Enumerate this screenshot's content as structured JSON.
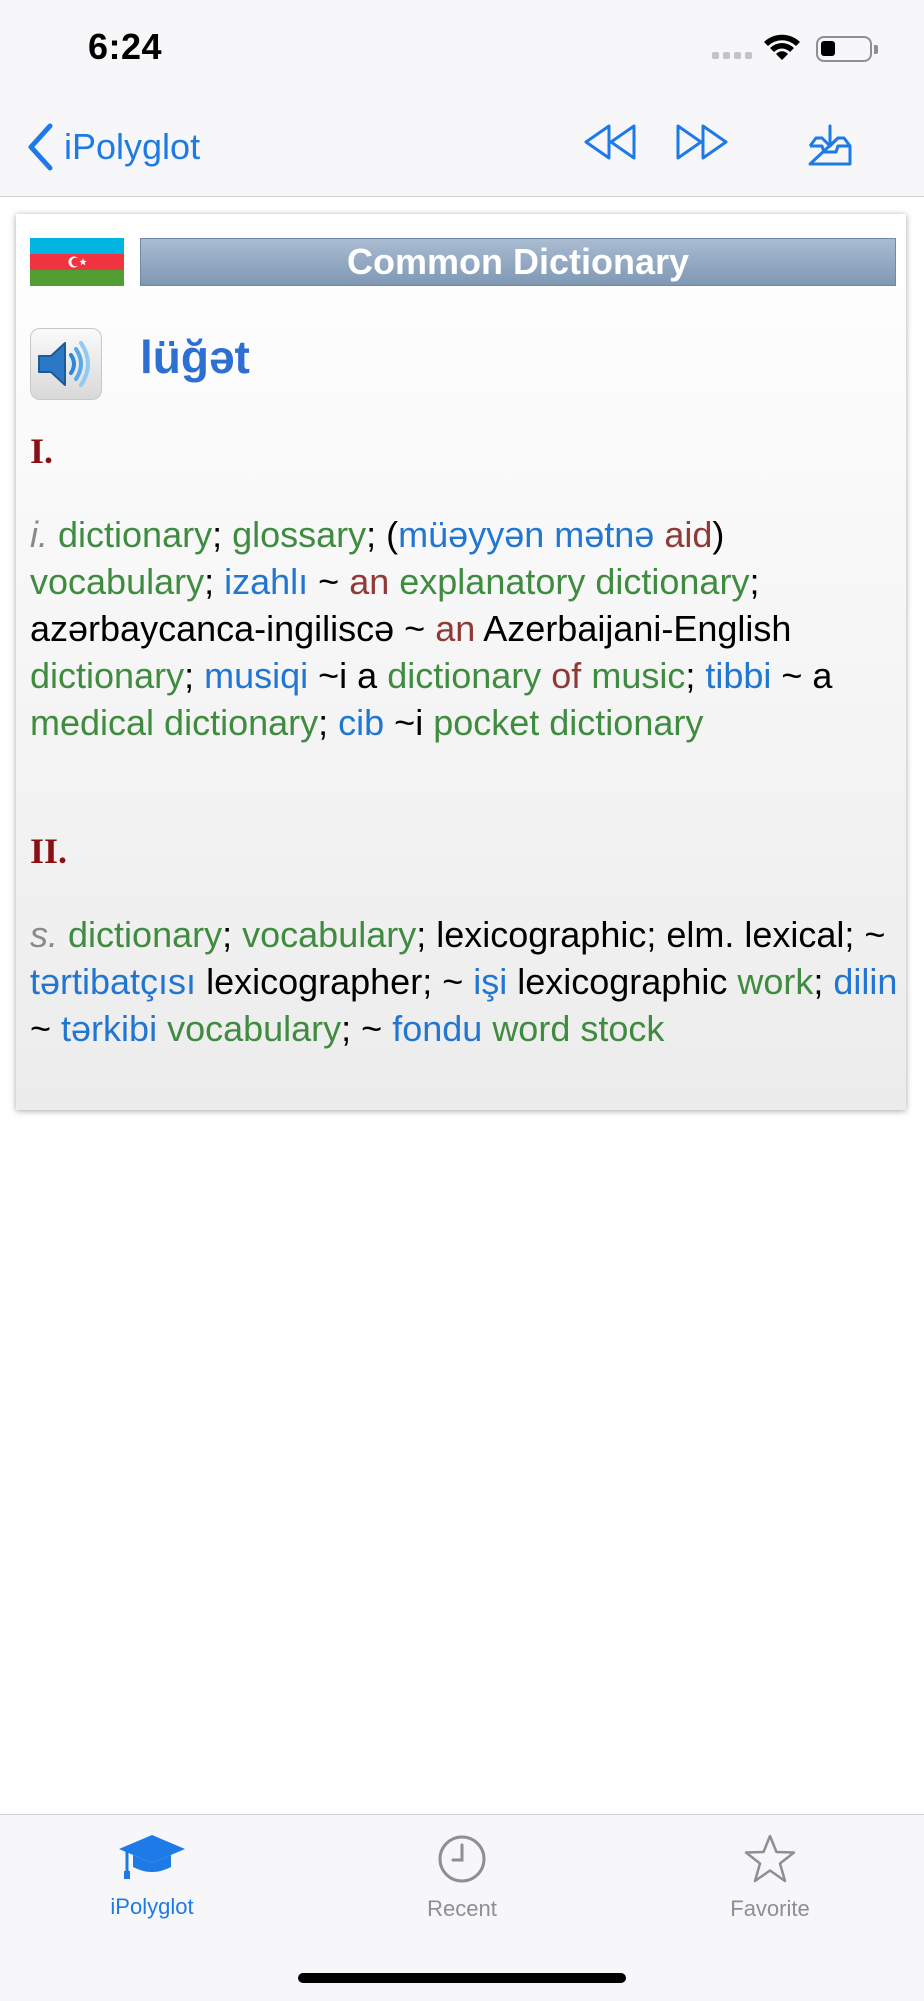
{
  "status_bar": {
    "time": "6:24"
  },
  "nav": {
    "back_label": "iPolyglot"
  },
  "card": {
    "title": "Common Dictionary",
    "headword": "lüğət",
    "sections": [
      {
        "number": "I."
      },
      {
        "number": "II."
      }
    ]
  },
  "tabs": [
    {
      "label": "iPolyglot",
      "active": true
    },
    {
      "label": "Recent",
      "active": false
    },
    {
      "label": "Favorite",
      "active": false
    }
  ],
  "colors": {
    "accent": "#1e7ae6",
    "english": "#3f8b3f",
    "azerbaijani": "#2176d2",
    "article": "#8f3a36",
    "section": "#8b1014",
    "inactive_tab": "#8e8e93",
    "flag_blue": "#00b5e2",
    "flag_red": "#ef3340",
    "flag_green": "#509e2f"
  },
  "icons": {
    "back": "chevron-left-icon",
    "rewind": "rewind-icon",
    "forward": "fast-forward-icon",
    "download": "tray-download-icon",
    "speaker": "speaker-icon",
    "tab_home": "graduation-cap-icon",
    "tab_recent": "clock-icon",
    "tab_favorite": "star-icon"
  }
}
